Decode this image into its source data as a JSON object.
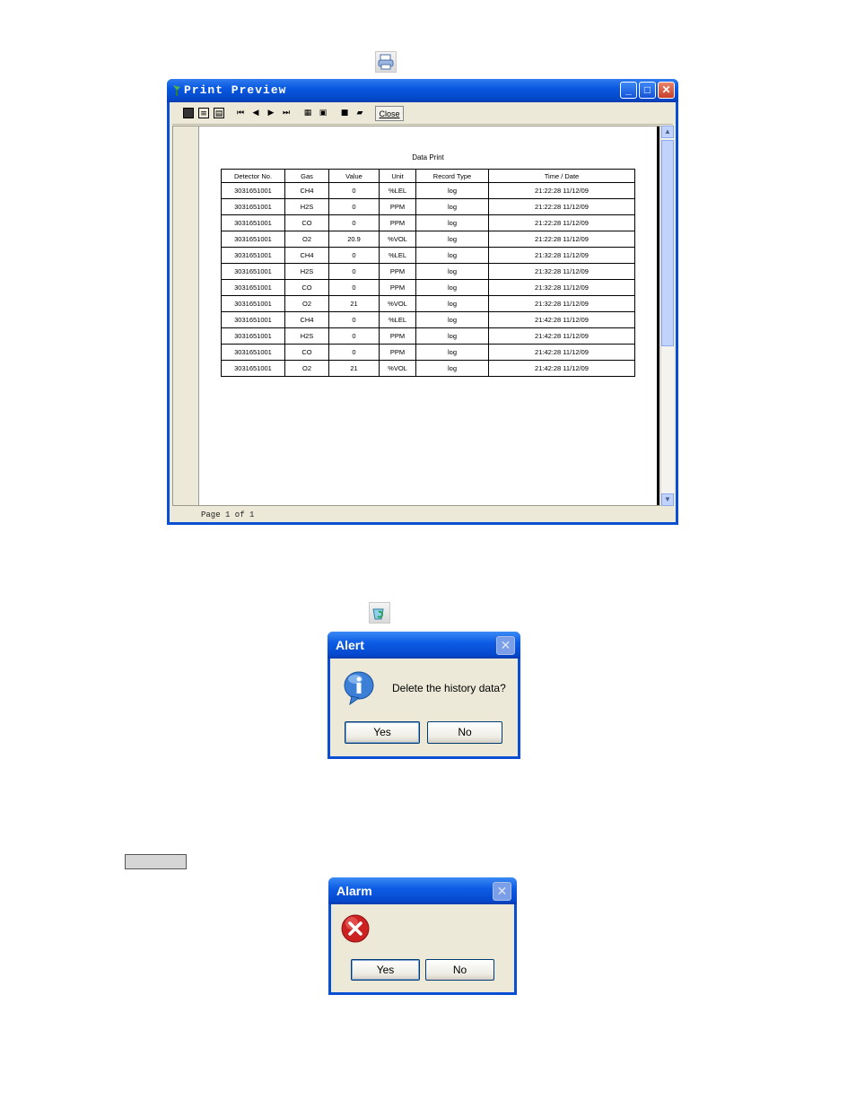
{
  "icons": {
    "print_icon": "printer-icon",
    "delete_icon": "recycle-icon"
  },
  "print_preview": {
    "title": "Print Preview",
    "toolbar_close_label": "Close",
    "status": "Page 1 of 1",
    "report": {
      "title": "Data Print",
      "columns": [
        "Detector No.",
        "Gas",
        "Value",
        "Unit",
        "Record Type",
        "Time / Date"
      ],
      "rows": [
        [
          "3031651001",
          "CH4",
          "0",
          "%LEL",
          "log",
          "21:22:28 11/12/09"
        ],
        [
          "3031651001",
          "H2S",
          "0",
          "PPM",
          "log",
          "21:22:28 11/12/09"
        ],
        [
          "3031651001",
          "CO",
          "0",
          "PPM",
          "log",
          "21:22:28 11/12/09"
        ],
        [
          "3031651001",
          "O2",
          "20.9",
          "%VOL",
          "log",
          "21:22:28 11/12/09"
        ],
        [
          "3031651001",
          "CH4",
          "0",
          "%LEL",
          "log",
          "21:32:28 11/12/09"
        ],
        [
          "3031651001",
          "H2S",
          "0",
          "PPM",
          "log",
          "21:32:28 11/12/09"
        ],
        [
          "3031651001",
          "CO",
          "0",
          "PPM",
          "log",
          "21:32:28 11/12/09"
        ],
        [
          "3031651001",
          "O2",
          "21",
          "%VOL",
          "log",
          "21:32:28 11/12/09"
        ],
        [
          "3031651001",
          "CH4",
          "0",
          "%LEL",
          "log",
          "21:42:28 11/12/09"
        ],
        [
          "3031651001",
          "H2S",
          "0",
          "PPM",
          "log",
          "21:42:28 11/12/09"
        ],
        [
          "3031651001",
          "CO",
          "0",
          "PPM",
          "log",
          "21:42:28 11/12/09"
        ],
        [
          "3031651001",
          "O2",
          "21",
          "%VOL",
          "log",
          "21:42:28 11/12/09"
        ]
      ]
    }
  },
  "alert_dialog": {
    "title": "Alert",
    "message": "Delete the history data?",
    "yes": "Yes",
    "no": "No",
    "icon": "info-icon"
  },
  "alarm_dialog": {
    "title": "Alarm",
    "yes": "Yes",
    "no": "No",
    "icon": "error-icon"
  },
  "colors": {
    "xp_blue": "#0a4fd3",
    "dialog_face": "#ece9d8",
    "error_red": "#cc2222"
  }
}
